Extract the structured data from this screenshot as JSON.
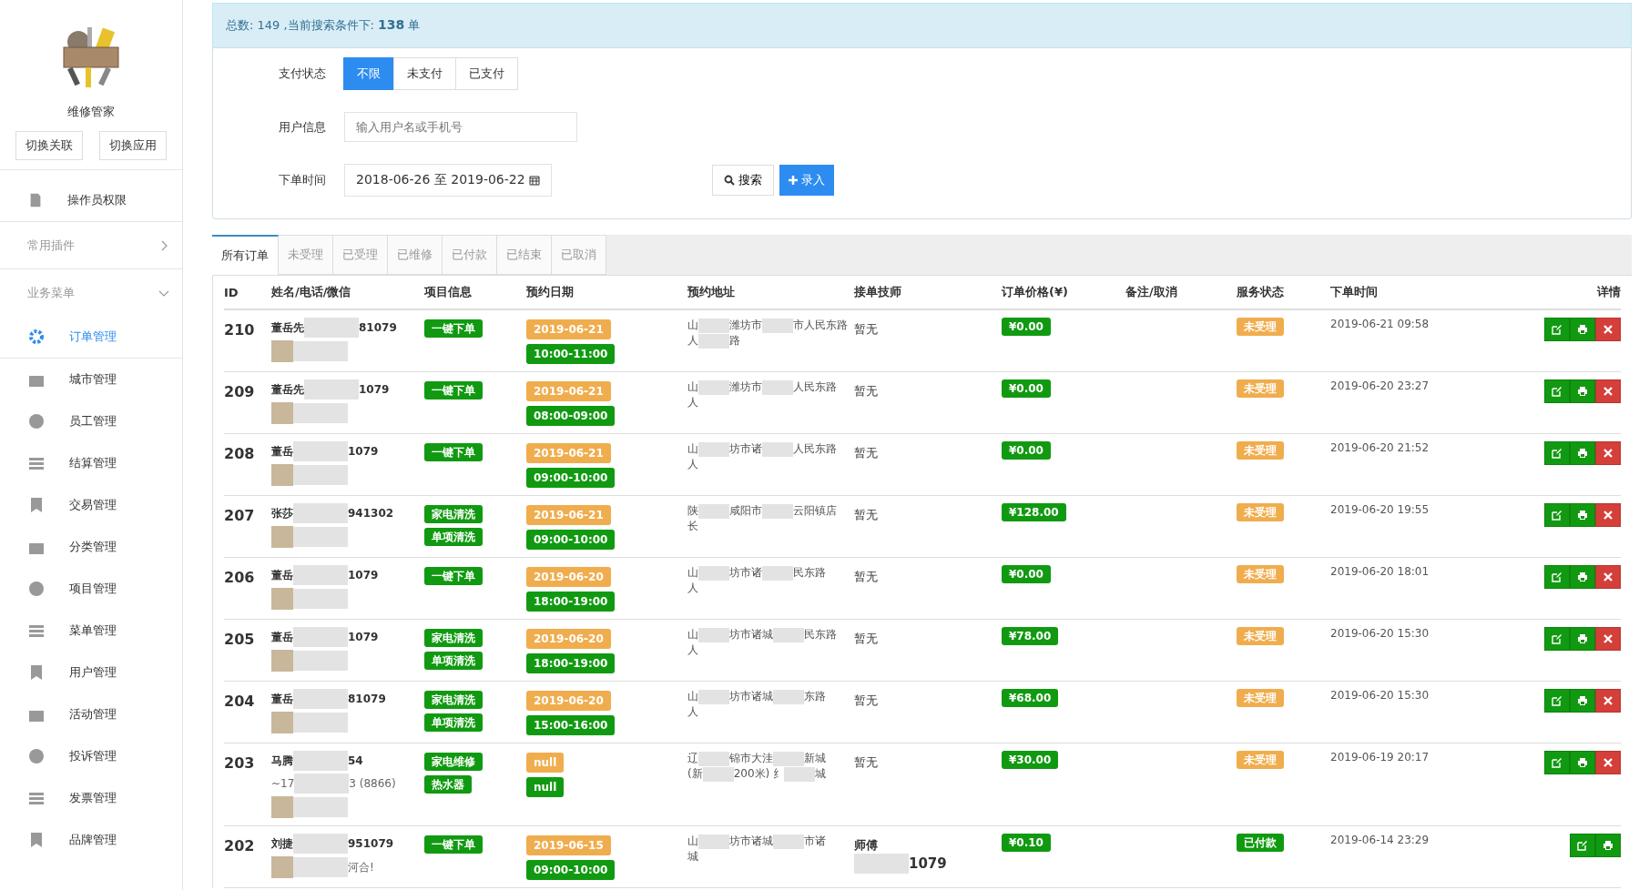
{
  "sidebar": {
    "app_name": "维修管家",
    "buttons": [
      "切换关联",
      "切换应用"
    ],
    "top_items": [
      {
        "label": "操作员权限",
        "selected": false
      }
    ],
    "sections": [
      {
        "title": "常用插件",
        "expanded": false
      },
      {
        "title": "业务菜单",
        "expanded": true,
        "items": [
          {
            "label": "订单管理",
            "selected": true
          },
          {
            "label": "城市管理",
            "selected": false
          },
          {
            "label": "员工管理",
            "selected": false
          },
          {
            "label": "结算管理",
            "selected": false
          },
          {
            "label": "交易管理",
            "selected": false
          },
          {
            "label": "分类管理",
            "selected": false
          },
          {
            "label": "项目管理",
            "selected": false
          },
          {
            "label": "菜单管理",
            "selected": false
          },
          {
            "label": "用户管理",
            "selected": false
          },
          {
            "label": "活动管理",
            "selected": false
          },
          {
            "label": "投诉管理",
            "selected": false
          },
          {
            "label": "发票管理",
            "selected": false
          },
          {
            "label": "品牌管理",
            "selected": false
          }
        ]
      }
    ]
  },
  "summary": {
    "prefix": "总数: 149 ,当前搜索条件下: ",
    "count": "138",
    "suffix": "单"
  },
  "filters": {
    "payment": {
      "label": "支付状态",
      "options": [
        {
          "label": "不限",
          "selected": true
        },
        {
          "label": "未支付",
          "selected": false
        },
        {
          "label": "已支付",
          "selected": false
        }
      ]
    },
    "user": {
      "label": "用户信息",
      "placeholder": "输入用户名或手机号"
    },
    "date": {
      "label": "下单时间",
      "value": "2018-06-26 至 2019-06-22"
    },
    "search_button": "搜索",
    "add_button": "录入"
  },
  "tabs": [
    {
      "label": "所有订单",
      "selected": true
    },
    {
      "label": "未受理",
      "selected": false
    },
    {
      "label": "已受理",
      "selected": false
    },
    {
      "label": "已维修",
      "selected": false
    },
    {
      "label": "已付款",
      "selected": false
    },
    {
      "label": "已结束",
      "selected": false
    },
    {
      "label": "已取消",
      "selected": false
    }
  ],
  "table": {
    "columns": [
      "ID",
      "姓名/电话/微信",
      "项目信息",
      "预约日期",
      "预约地址",
      "接单技师",
      "订单价格(¥)",
      "备注/取消",
      "服务状态",
      "下单时间",
      "详情"
    ],
    "rows": [
      {
        "id": "210",
        "contact": [
          [
            "董岳先",
            "81079"
          ]
        ],
        "projects": [
          "一键下单"
        ],
        "date": "2019-06-21",
        "time": "10:00-11:00",
        "address": [
          [
            "山",
            "潍坊市",
            "市人民东路"
          ],
          [
            "人",
            "路"
          ]
        ],
        "technician": "暂无",
        "price": "¥0.00",
        "status": {
          "label": "未受理",
          "kind": "pending"
        },
        "ordered": "2019-06-21 09:58",
        "deletable": true
      },
      {
        "id": "209",
        "contact": [
          [
            "董岳先",
            "1079"
          ]
        ],
        "projects": [
          "一键下单"
        ],
        "date": "2019-06-21",
        "time": "08:00-09:00",
        "address": [
          [
            "山",
            "潍坊市",
            "人民东路"
          ],
          [
            "人"
          ]
        ],
        "technician": "暂无",
        "price": "¥0.00",
        "status": {
          "label": "未受理",
          "kind": "pending"
        },
        "ordered": "2019-06-20 23:27",
        "deletable": true
      },
      {
        "id": "208",
        "contact": [
          [
            "董岳",
            "1079"
          ]
        ],
        "projects": [
          "一键下单"
        ],
        "date": "2019-06-21",
        "time": "09:00-10:00",
        "address": [
          [
            "山",
            "坊市诸",
            "人民东路"
          ],
          [
            "人"
          ]
        ],
        "technician": "暂无",
        "price": "¥0.00",
        "status": {
          "label": "未受理",
          "kind": "pending"
        },
        "ordered": "2019-06-20 21:52",
        "deletable": true
      },
      {
        "id": "207",
        "contact": [
          [
            "张莎",
            "941302"
          ]
        ],
        "projects": [
          "家电清洗",
          "单项清洗"
        ],
        "date": "2019-06-21",
        "time": "09:00-10:00",
        "address": [
          [
            "陕",
            "咸阳市",
            "云阳镇店"
          ],
          [
            "长"
          ]
        ],
        "technician": "暂无",
        "price": "¥128.00",
        "status": {
          "label": "未受理",
          "kind": "pending"
        },
        "ordered": "2019-06-20 19:55",
        "deletable": true
      },
      {
        "id": "206",
        "contact": [
          [
            "董岳",
            "1079"
          ]
        ],
        "projects": [
          "一键下单"
        ],
        "date": "2019-06-20",
        "time": "18:00-19:00",
        "address": [
          [
            "山",
            "坊市诸",
            "民东路"
          ],
          [
            "人"
          ]
        ],
        "technician": "暂无",
        "price": "¥0.00",
        "status": {
          "label": "未受理",
          "kind": "pending"
        },
        "ordered": "2019-06-20 18:01",
        "deletable": true
      },
      {
        "id": "205",
        "contact": [
          [
            "董岳",
            "1079"
          ]
        ],
        "projects": [
          "家电清洗",
          "单项清洗"
        ],
        "date": "2019-06-20",
        "time": "18:00-19:00",
        "address": [
          [
            "山",
            "坊市诸城",
            "民东路"
          ],
          [
            "人"
          ]
        ],
        "technician": "暂无",
        "price": "¥78.00",
        "status": {
          "label": "未受理",
          "kind": "pending"
        },
        "ordered": "2019-06-20 15:30",
        "deletable": true
      },
      {
        "id": "204",
        "contact": [
          [
            "董岳",
            "81079"
          ]
        ],
        "projects": [
          "家电清洗",
          "单项清洗"
        ],
        "date": "2019-06-20",
        "time": "15:00-16:00",
        "address": [
          [
            "山",
            "坊市诸城",
            "东路"
          ],
          [
            "人"
          ]
        ],
        "technician": "暂无",
        "price": "¥68.00",
        "status": {
          "label": "未受理",
          "kind": "pending"
        },
        "ordered": "2019-06-20 15:30",
        "deletable": true
      },
      {
        "id": "203",
        "contact": [
          [
            "马腾",
            "54"
          ],
          [
            "~17",
            "3 (8866)"
          ]
        ],
        "projects": [
          "家电维修",
          "热水器"
        ],
        "date": "null",
        "time": "null",
        "address": [
          [
            "辽",
            "锦市大洼",
            "新城"
          ],
          [
            "(新",
            "200米) 纟",
            "城"
          ]
        ],
        "technician": "暂无",
        "price": "¥30.00",
        "status": {
          "label": "未受理",
          "kind": "pending"
        },
        "ordered": "2019-06-19 20:17",
        "deletable": true
      },
      {
        "id": "202",
        "contact": [
          [
            "刘捷",
            "951079"
          ],
          [
            "河合!"
          ]
        ],
        "projects": [
          "一键下单"
        ],
        "date": "2019-06-15",
        "time": "09:00-10:00",
        "address": [
          [
            "山",
            "坊市诸城",
            "市诸"
          ],
          [
            "城"
          ]
        ],
        "technician": "师傅",
        "technician_extra": "1079",
        "price": "¥0.10",
        "status": {
          "label": "已付款",
          "kind": "paid"
        },
        "ordered": "2019-06-14 23:29",
        "deletable": false
      }
    ]
  }
}
